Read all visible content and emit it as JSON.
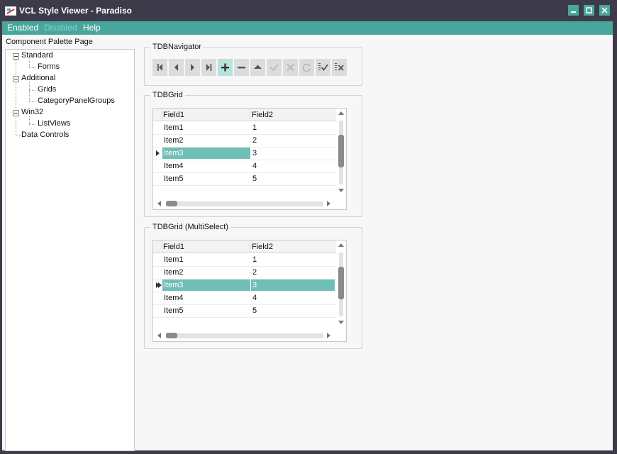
{
  "window": {
    "title": "VCL Style Viewer - Paradiso",
    "icon": "app-style-icon",
    "controls": [
      "minimize-icon",
      "maximize-icon",
      "close-icon"
    ]
  },
  "menu": {
    "items": [
      {
        "label": "Enabled",
        "enabled": true
      },
      {
        "label": "Disabled",
        "enabled": false
      },
      {
        "label": "Help",
        "enabled": true
      }
    ]
  },
  "sidebar": {
    "label": "Component Palette Page",
    "tree": [
      {
        "label": "Standard",
        "children": [
          "Forms"
        ]
      },
      {
        "label": "Additional",
        "children": [
          "Grids",
          "CategoryPanelGroups"
        ]
      },
      {
        "label": "Win32",
        "children": [
          "ListViews"
        ]
      },
      {
        "label": "Data Controls",
        "children": []
      }
    ]
  },
  "navigator": {
    "caption": "TDBNavigator",
    "buttons": [
      {
        "icon": "first-record-icon",
        "enabled": true
      },
      {
        "icon": "prior-record-icon",
        "enabled": true
      },
      {
        "icon": "next-record-icon",
        "enabled": true
      },
      {
        "icon": "last-record-icon",
        "enabled": true
      },
      {
        "icon": "insert-record-icon",
        "enabled": true
      },
      {
        "icon": "delete-record-icon",
        "enabled": true
      },
      {
        "icon": "edit-record-icon",
        "enabled": true
      },
      {
        "icon": "post-record-icon",
        "enabled": false
      },
      {
        "icon": "cancel-record-icon",
        "enabled": false
      },
      {
        "icon": "refresh-icon",
        "enabled": false
      },
      {
        "icon": "apply-updates-icon",
        "enabled": true
      },
      {
        "icon": "cancel-updates-icon",
        "enabled": true
      }
    ]
  },
  "grid1": {
    "caption": "TDBGrid",
    "columns": [
      "Field1",
      "Field2"
    ],
    "rows": [
      [
        "Item1",
        "1"
      ],
      [
        "Item2",
        "2"
      ],
      [
        "Item3",
        "3"
      ],
      [
        "Item4",
        "4"
      ],
      [
        "Item5",
        "5"
      ]
    ],
    "selected_row": 2
  },
  "grid2": {
    "caption": "TDBGrid (MultiSelect)",
    "columns": [
      "Field1",
      "Field2"
    ],
    "rows": [
      [
        "Item1",
        "1"
      ],
      [
        "Item2",
        "2"
      ],
      [
        "Item3",
        "3"
      ],
      [
        "Item4",
        "4"
      ],
      [
        "Item5",
        "5"
      ]
    ],
    "selected_row": 2
  },
  "colors": {
    "accent": "#47a79d",
    "selection": "#6fbfb6",
    "title_bg": "#3d3b4a"
  }
}
